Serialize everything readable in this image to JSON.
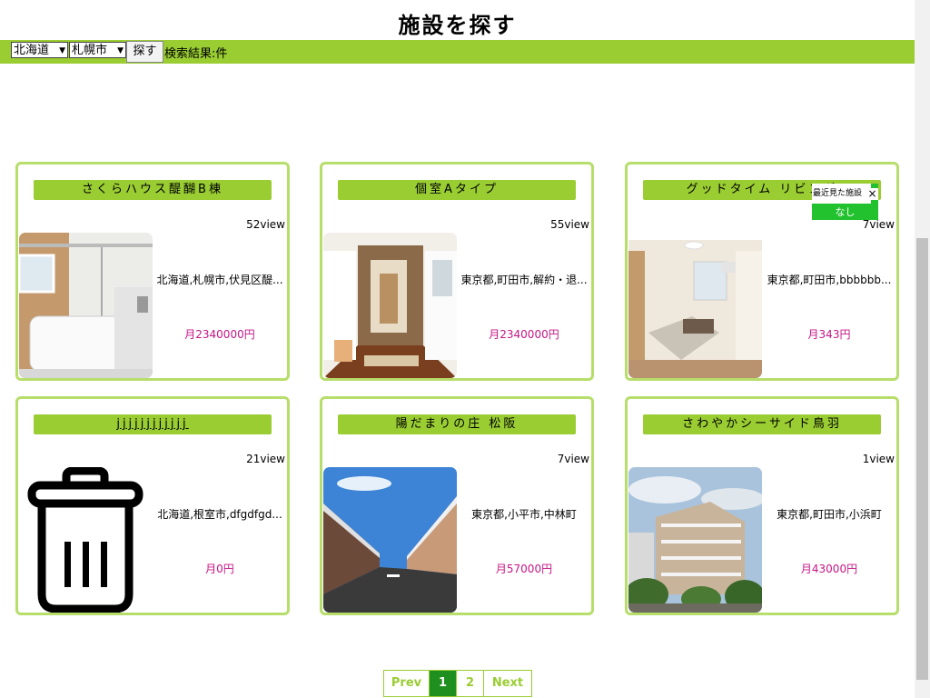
{
  "header": {
    "title": "施設を探す"
  },
  "search": {
    "prefecture": "北海道",
    "city": "札幌市",
    "button_label": "探す",
    "result_text": "検索結果:件"
  },
  "facilities": [
    {
      "name": "さくらハウス醍醐B棟",
      "views": "52view",
      "address": "北海道,札幌市,伏見区醍...",
      "price": "月2340000円",
      "image": "bathroom-photo"
    },
    {
      "name": "個室Aタイプ",
      "views": "55view",
      "address": "東京都,町田市,解約・退...",
      "price": "月2340000円",
      "image": "hallway-photo"
    },
    {
      "name": "グッドタイム リビング",
      "views": "7view",
      "address": "東京都,町田市,bbbbbb...",
      "price": "月343円",
      "image": "bedroom-photo"
    },
    {
      "name": "jjjjjjjjjjjj",
      "views": "21view",
      "address": "北海道,根室市,dfgdfgd...",
      "price": "月0円",
      "image": "trash-icon"
    },
    {
      "name": "陽だまりの庄 松阪",
      "views": "7view",
      "address": "東京都,小平市,中林町",
      "price": "月57000円",
      "image": "building-photo"
    },
    {
      "name": "さわやかシーサイド鳥羽",
      "views": "1view",
      "address": "東京都,町田市,小浜町",
      "price": "月43000円",
      "image": "apartment-photo"
    }
  ],
  "recent_popup": {
    "title": "最近見た施設",
    "close": "×",
    "content": "なし"
  },
  "pagination": {
    "prev": "Prev",
    "pages": [
      "1",
      "2"
    ],
    "next": "Next",
    "current": "1"
  },
  "colors": {
    "accent": "#9acd32",
    "card_border": "#b7dd6a",
    "price": "#c71585",
    "active_page": "#1f8f1f",
    "popup": "#22c22e"
  }
}
